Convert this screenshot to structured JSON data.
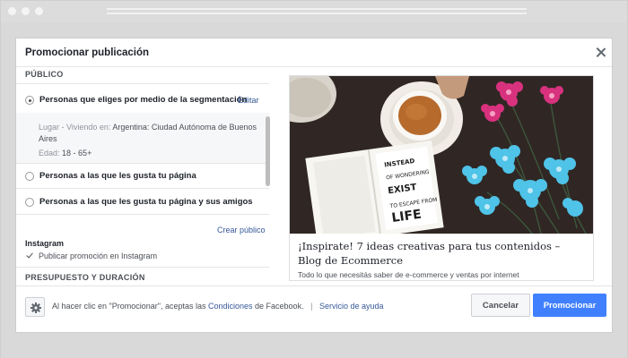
{
  "dialog": {
    "title": "Promocionar publicación"
  },
  "audience": {
    "section_label": "PÚBLICO",
    "option_segmentation": "Personas que eliges por medio de la segmentación",
    "edit_label": "Editar",
    "location_label": "Lugar - Viviendo en:",
    "location_value_line1": "Argentina: Ciudad Autónoma de Buenos",
    "location_value_line2": "Aires",
    "age_label": "Edad:",
    "age_value": "18 - 65+",
    "option_page_likes": "Personas a las que les gusta tu página",
    "option_page_likes_friends": "Personas a las que les gusta tu página y sus amigos",
    "create_audience_label": "Crear público",
    "instagram_label": "Instagram",
    "instagram_checkbox_label": "Publicar promoción en Instagram"
  },
  "budget": {
    "section_label": "PRESUPUESTO Y DURACIÓN"
  },
  "preview": {
    "title": "¡Inspirate! 7 ideas creativas para tus contenidos – Blog de Ecommerce",
    "description": "Todo lo que necesitás saber de e-commerce y ventas por internet",
    "book_text": "INSTEAD OF WONDERING WHEN YOUR NEXT VACATION IS, MAYBE YOU SHOULD SET UP A LIFE YOU DON'T NEED TO ESCAPE FROM",
    "image_colors": {
      "table": "#2b2321",
      "cup": "#f4f1ea",
      "coffee": "#b66a2c",
      "pink_flower": "#d8327e",
      "blue_flower": "#4fc3e8"
    }
  },
  "footer": {
    "terms_prefix": "Al hacer clic en \"Promocionar\", aceptas las",
    "terms_link": "Condiciones",
    "terms_suffix": "de Facebook.",
    "separator": "|",
    "help_link": "Servicio de ayuda",
    "cancel_label": "Cancelar",
    "promote_label": "Promocionar"
  },
  "colors": {
    "accent": "#4080ff",
    "link": "#365899"
  },
  "icons": {
    "close": "close-icon",
    "settings": "gear-icon",
    "check": "checkmark-icon"
  }
}
